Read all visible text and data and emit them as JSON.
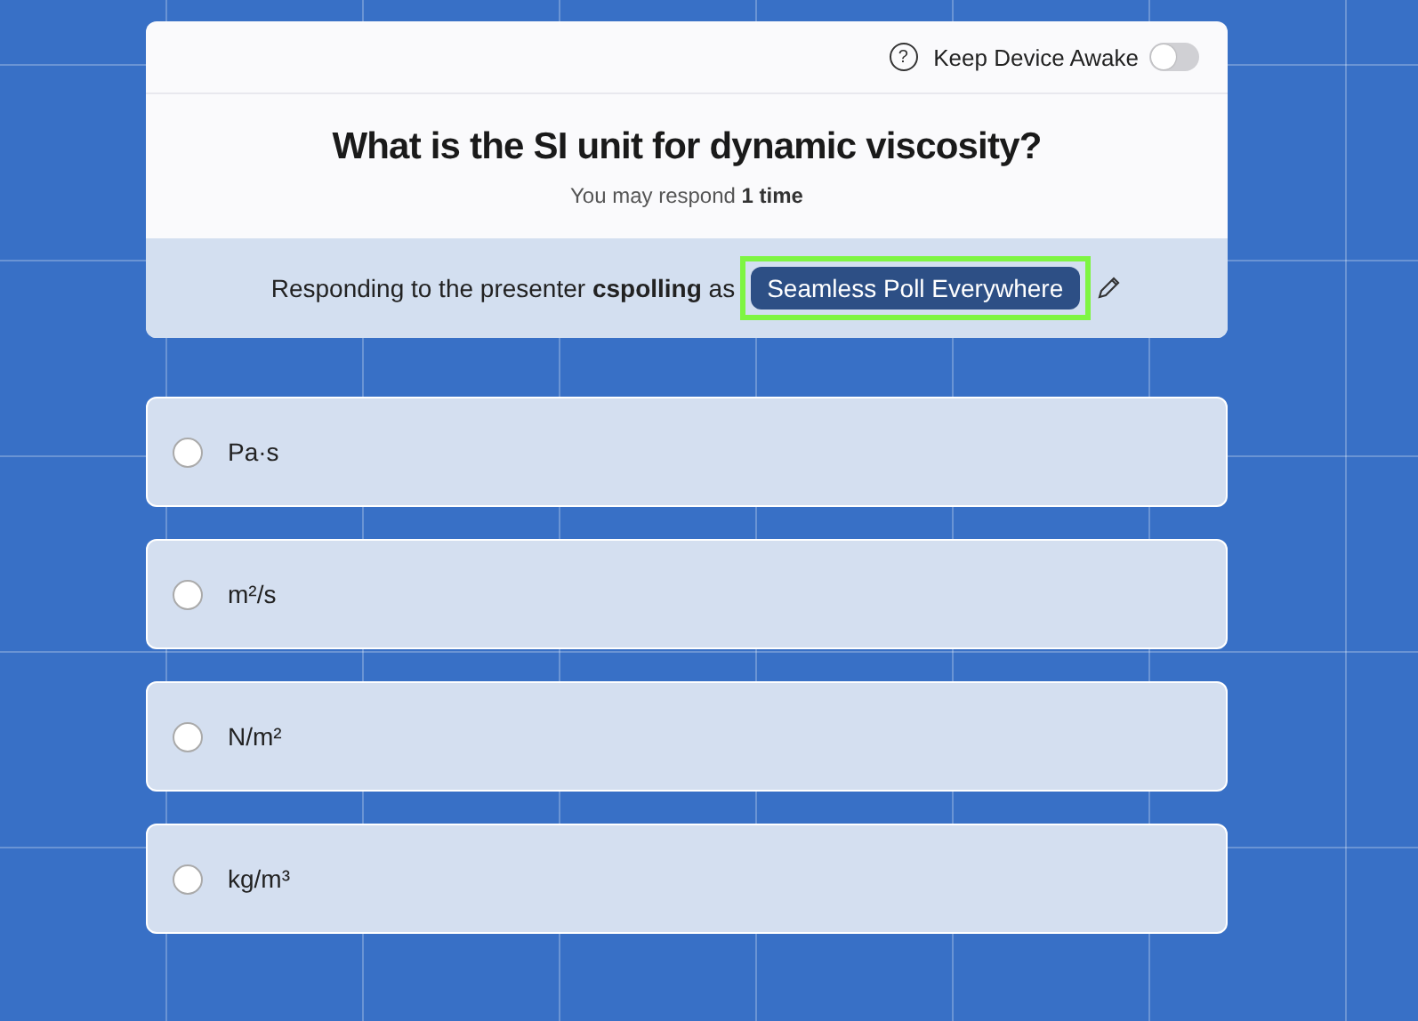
{
  "header": {
    "help_icon": "?",
    "keep_awake": {
      "label": "Keep Device Awake",
      "on": false
    }
  },
  "question": {
    "title": "What is the SI unit for dynamic viscosity?",
    "note": "You may respond **1 time**"
  },
  "responder": {
    "text": "Responding to the presenter **cspolling** as",
    "name": "Seamless Poll Everywhere",
    "highlighted": true
  },
  "options": [
    {
      "label": "Pa·s",
      "selected": false
    },
    {
      "label": "m²/s",
      "selected": false
    },
    {
      "label": "N/m²",
      "selected": false
    },
    {
      "label": "kg/m³",
      "selected": false
    }
  ]
}
